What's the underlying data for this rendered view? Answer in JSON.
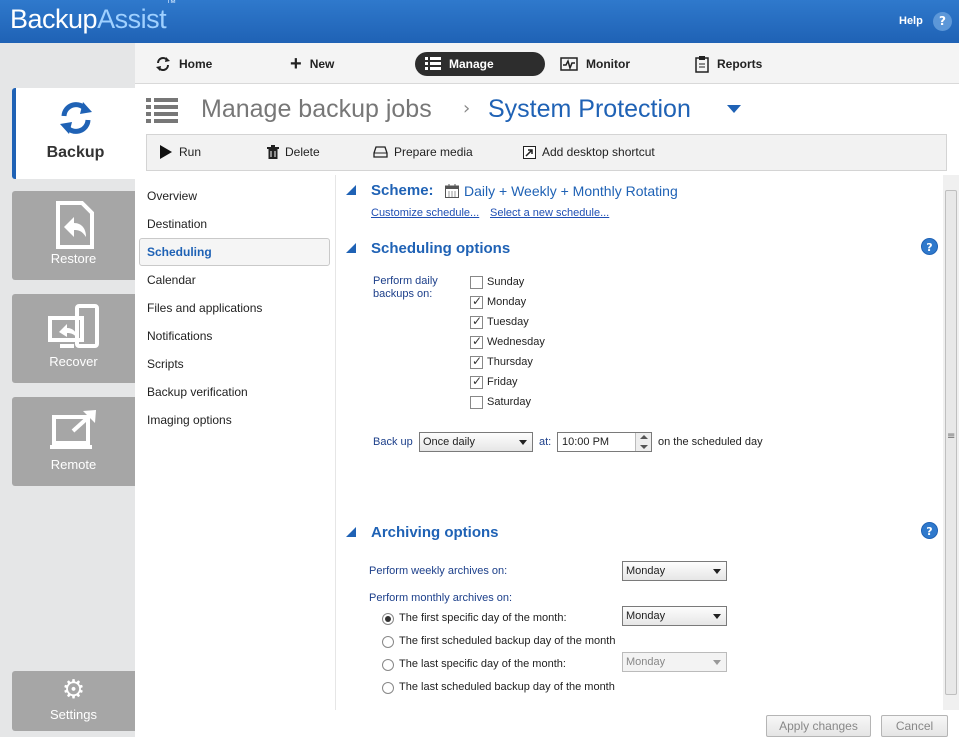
{
  "app": {
    "logo_part1": "Backup",
    "logo_part2": "Assist",
    "logo_tm": "™",
    "help_label": "Help",
    "help_icon": "?"
  },
  "rail": {
    "items": [
      {
        "label": "Backup",
        "icon": "backup-sync-icon",
        "active": true
      },
      {
        "label": "Restore",
        "icon": "restore-file-icon"
      },
      {
        "label": "Recover",
        "icon": "recover-monitor-icon"
      },
      {
        "label": "Remote",
        "icon": "remote-monitor-icon"
      },
      {
        "label": "Settings",
        "icon": "gear-icon"
      }
    ]
  },
  "topnav": {
    "items": [
      {
        "label": "Home",
        "icon": "refresh-icon"
      },
      {
        "label": "New",
        "icon": "plus-icon"
      },
      {
        "label": "Manage",
        "icon": "list-icon",
        "active": true
      },
      {
        "label": "Monitor",
        "icon": "monitor-pulse-icon"
      },
      {
        "label": "Reports",
        "icon": "clipboard-icon"
      }
    ]
  },
  "title": {
    "section": "Manage backup jobs",
    "separator": "›",
    "job": "System Protection"
  },
  "toolbar": {
    "run": "Run",
    "delete": "Delete",
    "prepare": "Prepare media",
    "shortcut": "Add desktop shortcut"
  },
  "sections": [
    "Overview",
    "Destination",
    "Scheduling",
    "Calendar",
    "Files and applications",
    "Notifications",
    "Scripts",
    "Backup verification",
    "Imaging options"
  ],
  "scheme": {
    "label": "Scheme:",
    "value": "Daily + Weekly + Monthly Rotating",
    "link_customize": "Customize schedule...",
    "link_select": "Select a new schedule..."
  },
  "scheduling": {
    "heading": "Scheduling options",
    "daily_label_1": "Perform daily",
    "daily_label_2": "backups on:",
    "days": [
      {
        "name": "Sunday",
        "checked": false
      },
      {
        "name": "Monday",
        "checked": true
      },
      {
        "name": "Tuesday",
        "checked": true
      },
      {
        "name": "Wednesday",
        "checked": true
      },
      {
        "name": "Thursday",
        "checked": true
      },
      {
        "name": "Friday",
        "checked": true
      },
      {
        "name": "Saturday",
        "checked": false
      }
    ],
    "backup_up_label": "Back up",
    "frequency": "Once daily",
    "at_label": "at:",
    "time": "10:00 PM",
    "suffix": "on the scheduled day"
  },
  "archiving": {
    "heading": "Archiving options",
    "weekly_label": "Perform weekly archives on:",
    "weekly_value": "Monday",
    "monthly_label": "Perform monthly archives on:",
    "options": [
      {
        "label": "The first specific day of the month:",
        "checked": true,
        "select": "Monday"
      },
      {
        "label": "The first scheduled backup day of the month",
        "checked": false
      },
      {
        "label": "The last specific day of the month:",
        "checked": false,
        "select": "Monday",
        "disabled": true
      },
      {
        "label": "The last scheduled backup day of the month",
        "checked": false
      }
    ]
  },
  "footer": {
    "apply": "Apply changes",
    "cancel": "Cancel"
  }
}
